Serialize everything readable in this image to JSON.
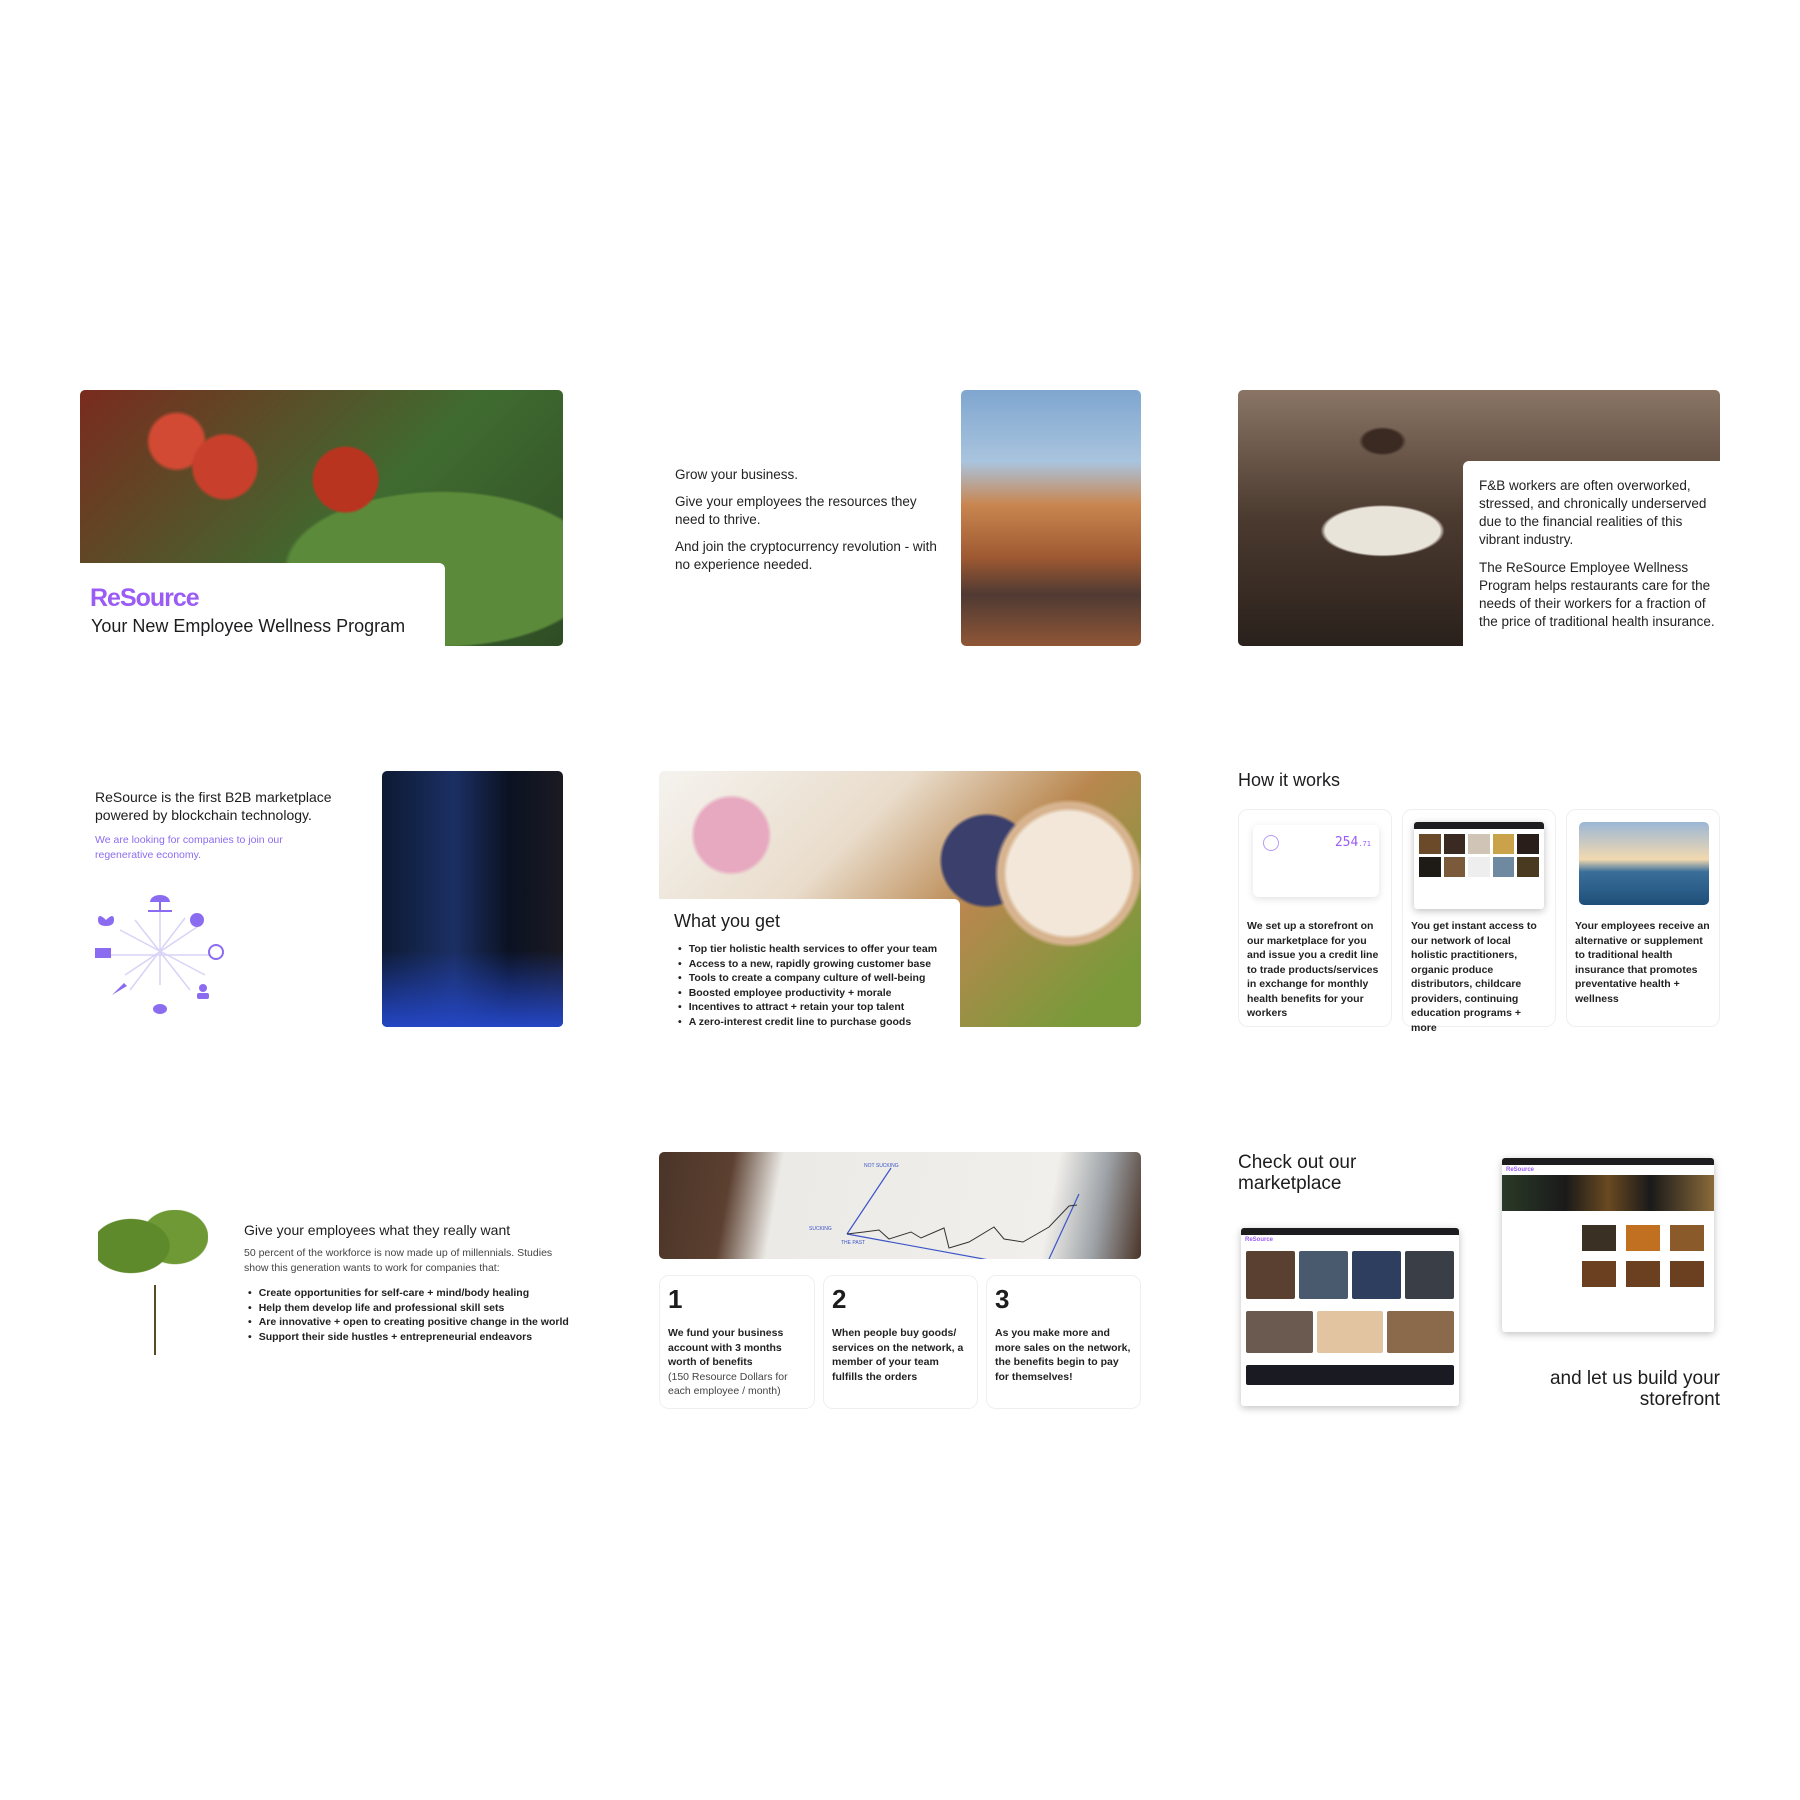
{
  "brand": {
    "logo": "ReSource",
    "color": "#9b5cf6"
  },
  "slide1": {
    "title": "Your New Employee Wellness Program"
  },
  "slide2": {
    "lines": [
      "Grow your business.",
      "Give your employees the resources they need to thrive.",
      "And join the cryptocurrency revolution - with no experience needed."
    ]
  },
  "slide3": {
    "p1": "F&B workers are often overworked, stressed, and chronically underserved due to the financial realities of this vibrant industry.",
    "p2": "The ReSource Employee Wellness Program helps restaurants care for the needs of their workers for a fraction of the price of traditional health insurance."
  },
  "slide4": {
    "headline": "ReSource is the first B2B marketplace powered by blockchain technology.",
    "subline": "We are looking for companies to join our regenerative economy.",
    "icons": [
      "beach-umbrella-icon",
      "brain-icon",
      "yin-yang-icon",
      "doctor-icon",
      "pills-icon",
      "carrot-icon",
      "factory-icon",
      "lotus-icon"
    ]
  },
  "slide5": {
    "title": "What you get",
    "bullets": [
      "Top tier holistic health services to offer your team",
      "Access to a new, rapidly growing customer base",
      "Tools to create a company culture of well-being",
      "Boosted employee productivity + morale",
      "Incentives to attract + retain your top talent",
      "A zero-interest credit line to purchase goods"
    ]
  },
  "slide6": {
    "title": "How it works",
    "card_amount": "254",
    "card_cents": ".71",
    "cards": [
      "We set up a storefront on our marketplace for you and issue you a credit line to trade products/services in exchange for monthly health benefits for your workers",
      "You get instant  access to our network of local holistic practitioners, organic produce distributors, childcare providers, continuing education programs + more",
      "Your employees receive an alternative or supplement to traditional health insurance that promotes preventative health + wellness"
    ]
  },
  "slide7": {
    "title": "Give your employees what they really want",
    "body": "50 percent of the workforce is now made up of millennials. Studies show this generation wants to work for companies that:",
    "bullets": [
      "Create opportunities for self-care + mind/body healing",
      "Help them develop life and professional skill sets",
      "Are innovative + open to creating positive change in the world",
      "Support their side hustles + entrepreneurial endeavors"
    ]
  },
  "slide8": {
    "chart_labels": {
      "top": "NOT SUCKING",
      "left": "SUCKING",
      "bottom": "THE PAST"
    },
    "steps": [
      {
        "num": "1",
        "text": "We fund your business account with 3 months worth of benefits",
        "note": "(150 Resource Dollars for each employee / month)"
      },
      {
        "num": "2",
        "text": "When people buy goods/ services on the network, a member of your team fulfills the orders",
        "note": ""
      },
      {
        "num": "3",
        "text": "As you make more and more sales on the network, the benefits begin to pay for themselves!",
        "note": ""
      }
    ]
  },
  "slide9": {
    "title": "Check out our marketplace",
    "caption": "and let us build your storefront",
    "shot_logo": "ReSource"
  }
}
